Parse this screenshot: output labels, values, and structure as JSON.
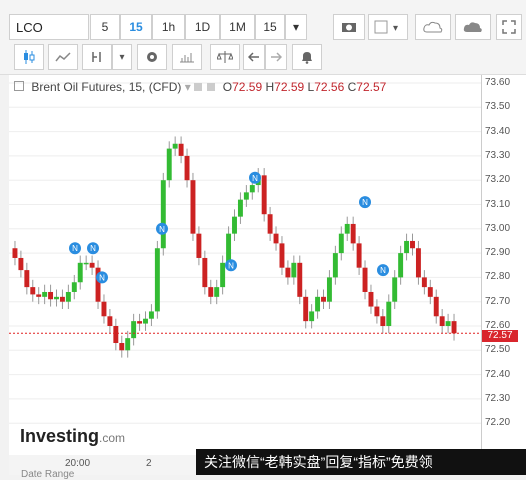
{
  "toolbar": {
    "symbol": "LCO",
    "intervals": [
      "5",
      "15",
      "1h",
      "1D",
      "1M"
    ],
    "active_interval": "15",
    "extra_interval": "15"
  },
  "chart": {
    "title": "Brent Oil Futures, 15, (CFD)",
    "open_label": "O",
    "open": "72.59",
    "high_label": "H",
    "high": "72.59",
    "low_label": "L",
    "low": "72.56",
    "close_label": "C",
    "close": "72.57",
    "current_price": "72.57",
    "y_ticks": [
      "73.60",
      "73.50",
      "73.40",
      "73.30",
      "73.20",
      "73.10",
      "73.00",
      "72.90",
      "72.80",
      "72.70",
      "72.60",
      "72.50",
      "72.40",
      "72.30",
      "72.20"
    ],
    "x_ticks": [
      "20:00",
      "2"
    ],
    "x_axis_label": "Date Range",
    "logo": "Investing",
    "logo_suffix": ".com",
    "news_marker": "N"
  },
  "banner": {
    "text": "关注微信“老韩实盘”回复“指标”免费领"
  },
  "colors": {
    "up": "#33bb33",
    "down": "#cc2222",
    "price_line": "#e02020",
    "news": "#2a8de0"
  }
}
